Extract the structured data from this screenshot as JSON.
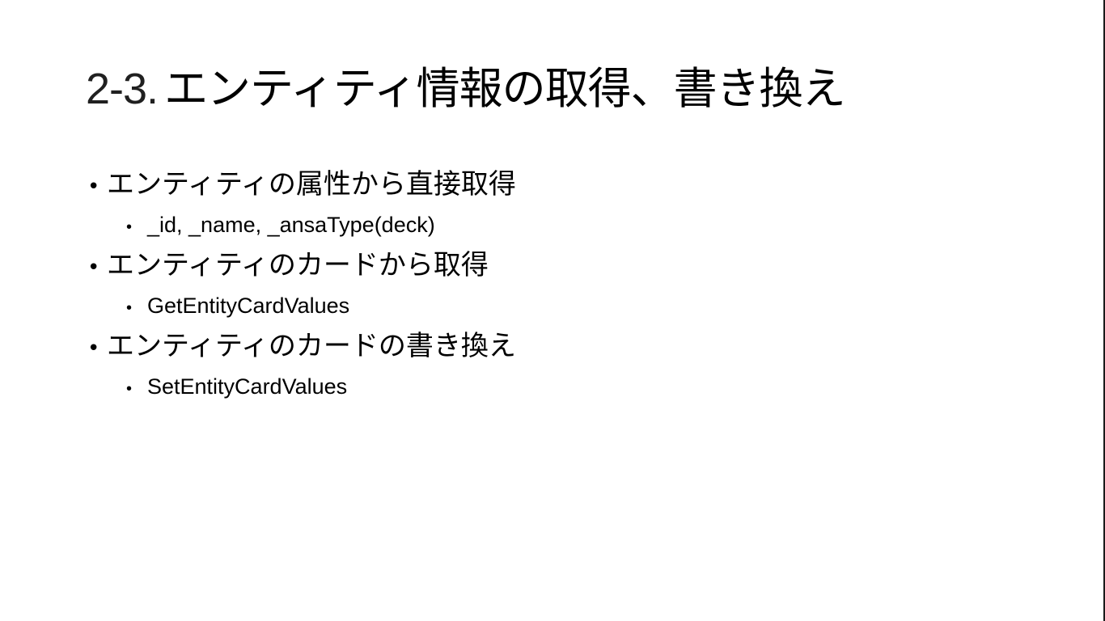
{
  "slide": {
    "title_number": "2-3.",
    "title_text": "エンティティ情報の取得、書き換え",
    "bullets": [
      {
        "text": "エンティティの属性から直接取得",
        "sub": [
          "_id, _name, _ansaType(deck)"
        ]
      },
      {
        "text": "エンティティのカードから取得",
        "sub": [
          "GetEntityCardValues"
        ]
      },
      {
        "text": "エンティティのカードの書き換え",
        "sub": [
          "SetEntityCardValues"
        ]
      }
    ],
    "bullet_glyph": "•"
  }
}
